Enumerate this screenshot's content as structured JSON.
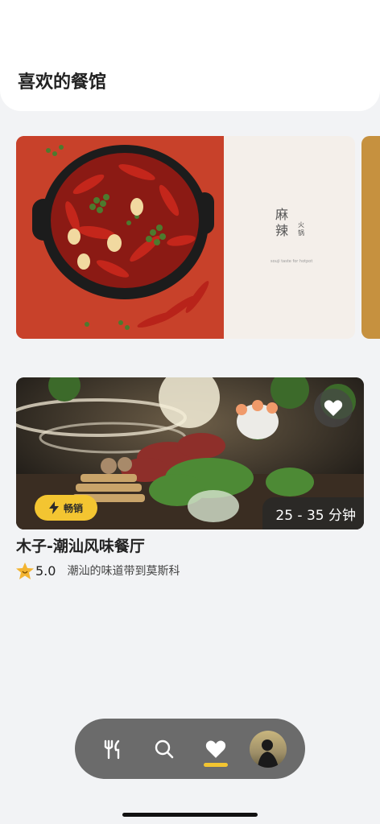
{
  "header": {
    "title": "喜欢的餐馆"
  },
  "carousel": {
    "brand_name": "麻辣",
    "brand_sub": "火锅",
    "brand_tagline": "souji taste for hotpot"
  },
  "restaurant": {
    "name": "木子-潮汕风味餐厅",
    "badge": "畅销",
    "eta": "25 - 35 分钟",
    "rating": "5.0",
    "description": "潮汕的味道带到莫斯科",
    "favorited": true
  },
  "bottom_nav": {
    "items": [
      {
        "icon": "fork-knife-icon",
        "active": false
      },
      {
        "icon": "search-icon",
        "active": false
      },
      {
        "icon": "heart-icon",
        "active": true
      },
      {
        "icon": "avatar",
        "active": false
      }
    ]
  },
  "colors": {
    "accent": "#f3c531",
    "background": "#f2f3f5",
    "nav": "#6b6b6b"
  }
}
